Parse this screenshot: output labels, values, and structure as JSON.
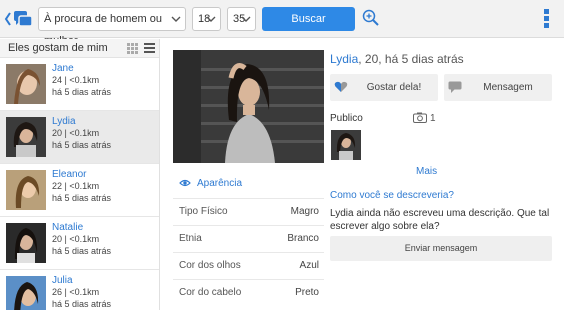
{
  "topbar": {
    "back_icon": "back-chat-icon",
    "seek_value": "À procura de homem ou mulher",
    "age_min": "18",
    "age_max": "35",
    "search_label": "Buscar",
    "zoom_icon": "zoom-in-icon",
    "menu_icon": "vertical-menu-icon",
    "accent": "#2e89e6"
  },
  "sidebar": {
    "title": "Eles gostam de mim",
    "items": [
      {
        "name": "Jane",
        "meta": "24 | <0.1km",
        "when": "há 5 dias atrás"
      },
      {
        "name": "Lydia",
        "meta": "20 | <0.1km",
        "when": "há 5 dias atrás"
      },
      {
        "name": "Eleanor",
        "meta": "22 | <0.1km",
        "when": "há 5 dias atrás"
      },
      {
        "name": "Natalie",
        "meta": "20 | <0.1km",
        "when": "há 5 dias atrás"
      },
      {
        "name": "Julia",
        "meta": "26 | <0.1km",
        "when": "há 5 dias atrás"
      }
    ]
  },
  "profile": {
    "name": "Lydia",
    "headline_rest": ", 20, há 5 dias atrás",
    "like_label": "Gostar dela!",
    "message_label": "Mensagem",
    "public_label": "Publico",
    "photo_count": "1",
    "more_label": "Mais",
    "describe_question": "Como você se descreveria?",
    "description": "Lydia ainda não escreveu uma descrição. Que tal escrever algo sobre ela?",
    "send_label": "Enviar mensagem",
    "appearance_label": "Aparência",
    "attributes": [
      {
        "key": "Tipo Físico",
        "value": "Magro"
      },
      {
        "key": "Etnia",
        "value": "Branco"
      },
      {
        "key": "Cor dos olhos",
        "value": "Azul"
      },
      {
        "key": "Cor do cabelo",
        "value": "Preto"
      }
    ]
  }
}
